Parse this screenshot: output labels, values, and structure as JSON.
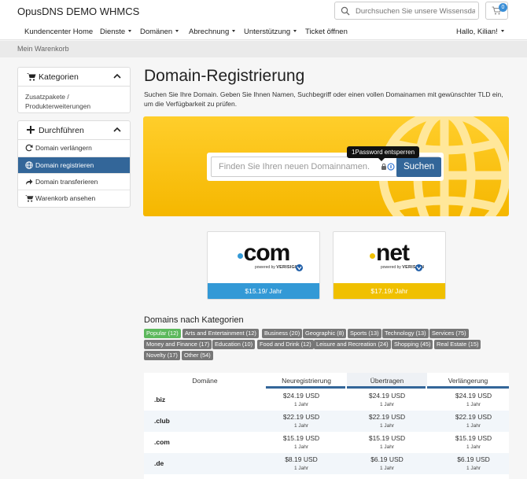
{
  "header": {
    "brand": "OpusDNS DEMO WHMCS",
    "search_placeholder": "Durchsuchen Sie unsere Wissensdat",
    "cart_count": "0"
  },
  "nav": {
    "items": [
      {
        "label": "Kundencenter Home"
      },
      {
        "label": "Dienste"
      },
      {
        "label": "Domänen"
      },
      {
        "label": "Abrechnung"
      },
      {
        "label": "Unterstützung"
      },
      {
        "label": "Ticket öffnen"
      }
    ],
    "user": "Hallo, Kilian!"
  },
  "breadcrumb": "Mein Warenkorb",
  "sidebar": {
    "categories": {
      "title": "Kategorien",
      "body": "Zusatzpakete / Produkterweiterungen"
    },
    "actions": {
      "title": "Durchführen",
      "items": [
        {
          "label": "Domain verlängern"
        },
        {
          "label": "Domain registrieren"
        },
        {
          "label": "Domain transferieren"
        },
        {
          "label": "Warenkorb ansehen"
        }
      ]
    }
  },
  "main": {
    "title": "Domain-Registrierung",
    "intro": "Suchen Sie Ihre Domain. Geben Sie Ihnen Namen, Suchbegriff oder einen vollen Domainamen mit gewünschter TLD ein, um die Verfügbarkeit zu prüfen.",
    "search_placeholder": "Finden Sie Ihren neuen Domainnamen.",
    "search_button": "Suchen",
    "tooltip": "1Password entsperren"
  },
  "tld_cards": [
    {
      "name": "com",
      "powered": "powered by",
      "brand": "VERISIGN",
      "price": "$15.19/ Jahr",
      "color": "#3399d6"
    },
    {
      "name": "net",
      "powered": "powered by",
      "brand": "VERISIGN",
      "price": "$17.19/ Jahr",
      "color": "#f0c000"
    }
  ],
  "categories": {
    "title": "Domains nach Kategorien",
    "tags": [
      "Popular (12)",
      "Arts and Entertainment (12)",
      "Business (20)",
      "Geographic (8)",
      "Sports (13)",
      "Technology (13)",
      "Services (75)",
      "Money and Finance (17)",
      "Education (10)",
      "Food and Drink (12)",
      "Leisure and Recreation (24)",
      "Shopping (45)",
      "Real Estate (15)",
      "Novelty (17)",
      "Other (54)"
    ]
  },
  "pricing": {
    "headers": [
      "Domäne",
      "Neuregistrierung",
      "Übertragen",
      "Verlängerung"
    ],
    "rows": [
      {
        "domain": ".biz",
        "reg": "$24.19 USD",
        "reg_p": "1 Jahr",
        "tr": "$24.19 USD",
        "tr_p": "1 Jahr",
        "ren": "$24.19 USD",
        "ren_p": "1 Jahr"
      },
      {
        "domain": ".club",
        "reg": "$22.19 USD",
        "reg_p": "1 Jahr",
        "tr": "$22.19 USD",
        "tr_p": "1 Jahr",
        "ren": "$22.19 USD",
        "ren_p": "1 Jahr"
      },
      {
        "domain": ".com",
        "reg": "$15.19 USD",
        "reg_p": "1 Jahr",
        "tr": "$15.19 USD",
        "tr_p": "1 Jahr",
        "ren": "$15.19 USD",
        "ren_p": "1 Jahr"
      },
      {
        "domain": ".de",
        "reg": "$8.19 USD",
        "reg_p": "1 Jahr",
        "tr": "$6.19 USD",
        "tr_p": "1 Jahr",
        "ren": "$6.19 USD",
        "ren_p": "1 Jahr"
      }
    ]
  },
  "colors": {
    "primary": "#336699",
    "accent": "#f5b700",
    "active_tag": "#5cb85c"
  }
}
